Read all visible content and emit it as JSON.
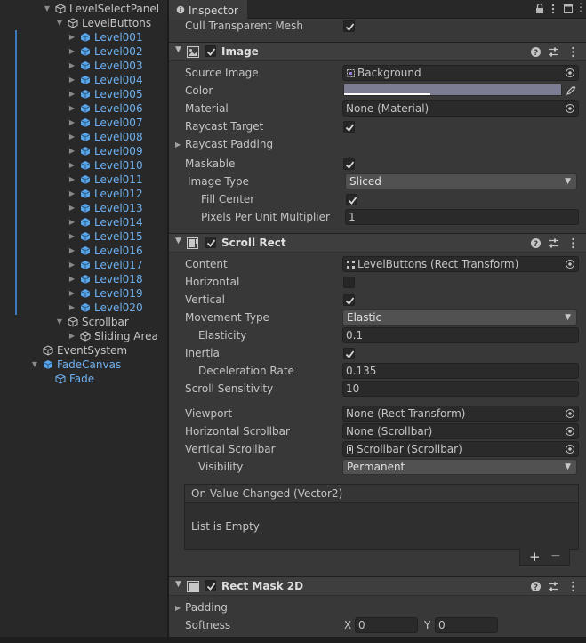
{
  "hierarchy": {
    "items": [
      {
        "label": "LevelSelectPanel"
      },
      {
        "label": "LevelButtons"
      },
      {
        "label": "Level001"
      },
      {
        "label": "Level002"
      },
      {
        "label": "Level003"
      },
      {
        "label": "Level004"
      },
      {
        "label": "Level005"
      },
      {
        "label": "Level006"
      },
      {
        "label": "Level007"
      },
      {
        "label": "Level008"
      },
      {
        "label": "Level009"
      },
      {
        "label": "Level010"
      },
      {
        "label": "Level011"
      },
      {
        "label": "Level012"
      },
      {
        "label": "Level013"
      },
      {
        "label": "Level014"
      },
      {
        "label": "Level015"
      },
      {
        "label": "Level016"
      },
      {
        "label": "Level017"
      },
      {
        "label": "Level018"
      },
      {
        "label": "Level019"
      },
      {
        "label": "Level020"
      },
      {
        "label": "Scrollbar"
      },
      {
        "label": "Sliding Area"
      },
      {
        "label": "EventSystem"
      },
      {
        "label": "FadeCanvas"
      },
      {
        "label": "Fade"
      }
    ]
  },
  "inspector": {
    "tab_label": "Inspector",
    "cull_transparent_mesh": {
      "label": "Cull Transparent Mesh",
      "checked": true
    },
    "image": {
      "title": "Image",
      "source_image": {
        "label": "Source Image",
        "value": "Background"
      },
      "color": {
        "label": "Color",
        "value": "#7c7c93"
      },
      "material": {
        "label": "Material",
        "value": "None (Material)"
      },
      "raycast_target": {
        "label": "Raycast Target",
        "checked": true
      },
      "raycast_padding": {
        "label": "Raycast Padding"
      },
      "maskable": {
        "label": "Maskable",
        "checked": true
      },
      "image_type": {
        "label": "Image Type",
        "value": "Sliced"
      },
      "fill_center": {
        "label": "Fill Center",
        "checked": true
      },
      "ppu_multiplier": {
        "label": "Pixels Per Unit Multiplier",
        "value": "1"
      }
    },
    "scroll_rect": {
      "title": "Scroll Rect",
      "content": {
        "label": "Content",
        "value": "LevelButtons (Rect Transform)"
      },
      "horizontal": {
        "label": "Horizontal",
        "checked": false
      },
      "vertical": {
        "label": "Vertical",
        "checked": true
      },
      "movement_type": {
        "label": "Movement Type",
        "value": "Elastic"
      },
      "elasticity": {
        "label": "Elasticity",
        "value": "0.1"
      },
      "inertia": {
        "label": "Inertia",
        "checked": true
      },
      "deceleration_rate": {
        "label": "Deceleration Rate",
        "value": "0.135"
      },
      "scroll_sensitivity": {
        "label": "Scroll Sensitivity",
        "value": "10"
      },
      "viewport": {
        "label": "Viewport",
        "value": "None (Rect Transform)"
      },
      "horizontal_scrollbar": {
        "label": "Horizontal Scrollbar",
        "value": "None (Scrollbar)"
      },
      "vertical_scrollbar": {
        "label": "Vertical Scrollbar",
        "value": "Scrollbar (Scrollbar)"
      },
      "visibility": {
        "label": "Visibility",
        "value": "Permanent"
      },
      "on_value_changed": {
        "title": "On Value Changed (Vector2)",
        "empty_text": "List is Empty",
        "add": "+",
        "remove": "−"
      }
    },
    "rect_mask": {
      "title": "Rect Mask 2D",
      "padding": {
        "label": "Padding"
      },
      "softness": {
        "label": "Softness",
        "x_label": "X",
        "x_value": "0",
        "y_label": "Y",
        "y_value": "0"
      }
    }
  },
  "colors": {
    "accent_blue": "#4f9fe9",
    "color_swatch": "#7c7c93"
  }
}
